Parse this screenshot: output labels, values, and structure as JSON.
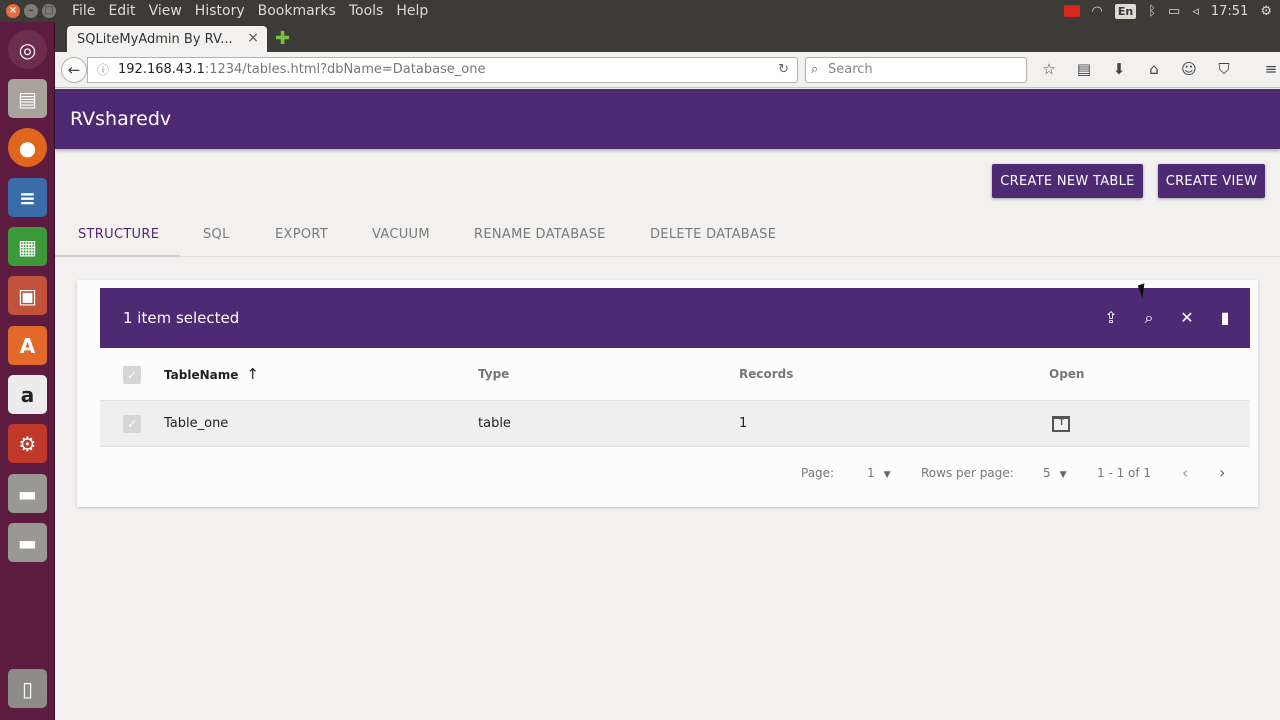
{
  "os": {
    "menus": [
      "File",
      "Edit",
      "View",
      "History",
      "Bookmarks",
      "Tools",
      "Help"
    ],
    "keyboard_layout": "En",
    "clock": "17:51"
  },
  "browser": {
    "tab_title": "SQLiteMyAdmin By RV...",
    "url_host": "192.168.43.1",
    "url_rest": ":1234/tables.html?dbName=Database_one",
    "search_placeholder": "Search"
  },
  "app": {
    "title": "RVsharedv",
    "create_table_label": "CREATE NEW TABLE",
    "create_view_label": "CREATE VIEW",
    "tabs": [
      {
        "label": "STRUCTURE",
        "active": true
      },
      {
        "label": "SQL"
      },
      {
        "label": "EXPORT"
      },
      {
        "label": "VACUUM"
      },
      {
        "label": "RENAME DATABASE"
      },
      {
        "label": "DELETE DATABASE"
      }
    ],
    "selection_text": "1 item selected",
    "table": {
      "headers": [
        "TableName",
        "Type",
        "Records",
        "Open"
      ],
      "rows": [
        {
          "name": "Table_one",
          "type": "table",
          "records": "1"
        }
      ]
    },
    "pagination": {
      "page_label": "Page:",
      "page_value": "1",
      "rows_label": "Rows per page:",
      "rows_value": "5",
      "range": "1 - 1 of 1"
    }
  },
  "colors": {
    "accent": "#4e2a75",
    "launcher": "#5d1b3f",
    "panel": "#3c3b37"
  }
}
